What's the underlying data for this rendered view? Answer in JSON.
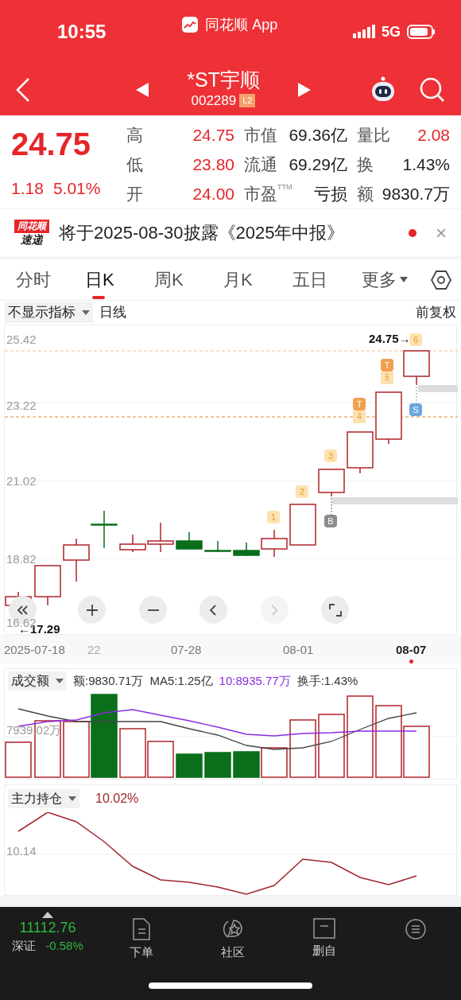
{
  "status_bar": {
    "time": "10:55",
    "app": "同花顺 App",
    "network": "5G"
  },
  "header": {
    "stock_name": "*ST宇顺",
    "code": "002289",
    "badge": "L2"
  },
  "quote": {
    "price": "24.75",
    "change": "1.18",
    "change_pct": "5.01%",
    "fields": [
      {
        "label": "高",
        "value": "24.75",
        "kind": "up"
      },
      {
        "label": "市值",
        "value": "69.36亿",
        "kind": "plain"
      },
      {
        "label": "量比",
        "value": "2.08",
        "kind": "up"
      },
      {
        "label": "低",
        "value": "23.80",
        "kind": "up"
      },
      {
        "label": "流通",
        "value": "69.29亿",
        "kind": "plain"
      },
      {
        "label": "换",
        "value": "1.43%",
        "kind": "plain"
      },
      {
        "label": "开",
        "value": "24.00",
        "kind": "up"
      },
      {
        "label": "市盈",
        "sup": "TTM",
        "value": "亏损",
        "kind": "plain"
      },
      {
        "label": "额",
        "value": "9830.7万",
        "kind": "plain"
      }
    ]
  },
  "banner": {
    "logo_top": "同花顺",
    "logo_bottom": "速递",
    "text": "将于2025-08-30披露《2025年中报》",
    "unread": true,
    "close": "×"
  },
  "tabs": [
    {
      "label": "分时",
      "selected": false,
      "kind": "tab"
    },
    {
      "label": "日K",
      "selected": true,
      "kind": "tab"
    },
    {
      "label": "周K",
      "selected": false,
      "kind": "tab"
    },
    {
      "label": "月K",
      "selected": false,
      "kind": "tab"
    },
    {
      "label": "五日",
      "selected": false,
      "kind": "tab"
    },
    {
      "label": "更多",
      "selected": false,
      "kind": "menu"
    }
  ],
  "chart_toolbar": {
    "indicator": "不显示指标",
    "period": "日线",
    "adjust": "前复权"
  },
  "kline": {
    "y_labels": [
      "25.42",
      "23.22",
      "21.02",
      "18.82",
      "16.62"
    ],
    "high_label": "24.75→",
    "low_label": "←17.29",
    "markers": [
      {
        "text": "6",
        "kind": "count"
      },
      {
        "text": "T",
        "sub": "5",
        "kind": "trade"
      },
      {
        "text": "T",
        "sub": "4",
        "kind": "trade"
      },
      {
        "text": "S",
        "kind": "sell"
      },
      {
        "text": "3",
        "kind": "count"
      },
      {
        "text": "2",
        "kind": "count"
      },
      {
        "text": "1",
        "kind": "count"
      },
      {
        "text": "B",
        "kind": "buy"
      }
    ],
    "controls": [
      {
        "kind": "collapse",
        "disabled": false
      },
      {
        "kind": "zoom_in",
        "disabled": false
      },
      {
        "kind": "zoom_out",
        "disabled": false
      },
      {
        "kind": "prev",
        "disabled": false
      },
      {
        "kind": "next",
        "disabled": true
      },
      {
        "kind": "fullscreen",
        "disabled": false
      }
    ],
    "dates": [
      {
        "label": "2025-07-18",
        "selected": false
      },
      {
        "label": "22",
        "selected": false
      },
      {
        "label": "07-28",
        "selected": false
      },
      {
        "label": "08-01",
        "selected": false
      },
      {
        "label": "08-07",
        "selected": true
      }
    ]
  },
  "volume": {
    "indicator": "成交额",
    "axis_label": "7939.02万",
    "stats": [
      {
        "text": "额:9830.71万",
        "color": "#333333"
      },
      {
        "text": "MA5:1.25亿",
        "color": "#333333"
      },
      {
        "text": "10:8935.77万",
        "color": "#8a2be2"
      },
      {
        "text": "换手:1.43%",
        "color": "#333333"
      }
    ]
  },
  "position": {
    "indicator": "主力持仓",
    "value": "10.02%",
    "axis_label": "10.14"
  },
  "bottom_nav": {
    "index_value": "11112.76",
    "index_name": "深证",
    "index_change": "-0.58%",
    "items": [
      {
        "label": "下单",
        "kind": "order"
      },
      {
        "label": "社区",
        "kind": "community"
      },
      {
        "label": "删自",
        "kind": "remove"
      },
      {
        "kind": "menu"
      }
    ]
  }
}
